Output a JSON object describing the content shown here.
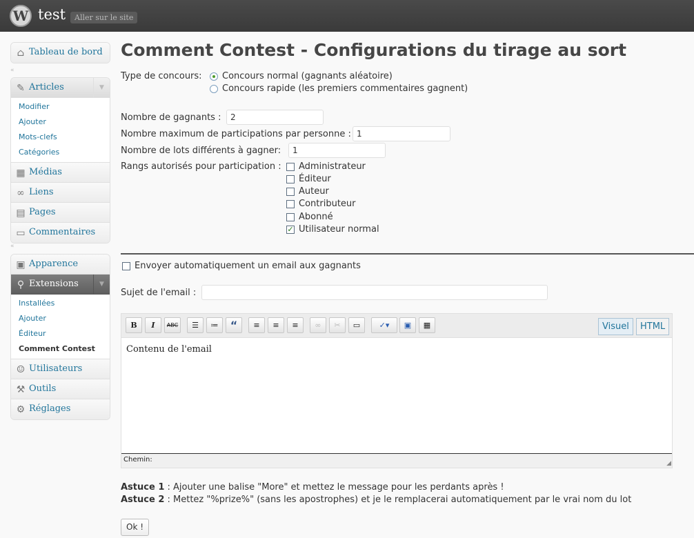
{
  "header": {
    "logo_letter": "W",
    "site_name": "test",
    "visit_site": "Aller sur le site"
  },
  "sidebar": {
    "dashboard": "Tableau de bord",
    "articles": {
      "label": "Articles",
      "items": [
        "Modifier",
        "Ajouter",
        "Mots-clefs",
        "Catégories"
      ]
    },
    "medias": "Médias",
    "liens": "Liens",
    "pages": "Pages",
    "commentaires": "Commentaires",
    "apparence": "Apparence",
    "extensions": {
      "label": "Extensions",
      "items": [
        "Installées",
        "Ajouter",
        "Éditeur",
        "Comment Contest"
      ],
      "current_item": "Comment Contest"
    },
    "utilisateurs": "Utilisateurs",
    "outils": "Outils",
    "reglages": "Réglages"
  },
  "page": {
    "title": "Comment Contest - Configurations du tirage au sort",
    "contest_type": {
      "label": "Type de concours:",
      "options": [
        {
          "label": "Concours normal (gagnants aléatoire)",
          "selected": true
        },
        {
          "label": "Concours rapide (les premiers commentaires gagnent)",
          "selected": false
        }
      ]
    },
    "winners": {
      "label": "Nombre de gagnants :",
      "value": "2"
    },
    "max_participations": {
      "label": "Nombre maximum de participations par personne :",
      "value": "1"
    },
    "prizes": {
      "label": "Nombre de lots différents à gagner:",
      "value": "1"
    },
    "ranks": {
      "label": "Rangs autorisés pour participation :",
      "options": [
        {
          "label": "Administrateur",
          "checked": false
        },
        {
          "label": "Éditeur",
          "checked": false
        },
        {
          "label": "Auteur",
          "checked": false
        },
        {
          "label": "Contributeur",
          "checked": false
        },
        {
          "label": "Abonné",
          "checked": false
        },
        {
          "label": "Utilisateur normal",
          "checked": true
        }
      ]
    },
    "auto_email": {
      "label": "Envoyer automatiquement un email aux gagnants",
      "checked": false
    },
    "email_subject": {
      "label": "Sujet de l'email :",
      "value": ""
    },
    "editor": {
      "tab_visual": "Visuel",
      "tab_html": "HTML",
      "active_tab": "Visuel",
      "content": "Contenu de l'email",
      "path_label": "Chemin:",
      "buttons": {
        "bold": "B",
        "italic": "I",
        "strike": "ABC",
        "quote": "“"
      }
    },
    "tips": [
      {
        "title": "Astuce 1",
        "text": " : Ajouter une balise \"More\" et mettez le message pour les perdants après !"
      },
      {
        "title": "Astuce 2",
        "text": " : Mettez \"%prize%\" (sans les apostrophes) et je le remplacerai automatiquement par le vrai nom du lot"
      }
    ],
    "submit": "Ok !"
  }
}
